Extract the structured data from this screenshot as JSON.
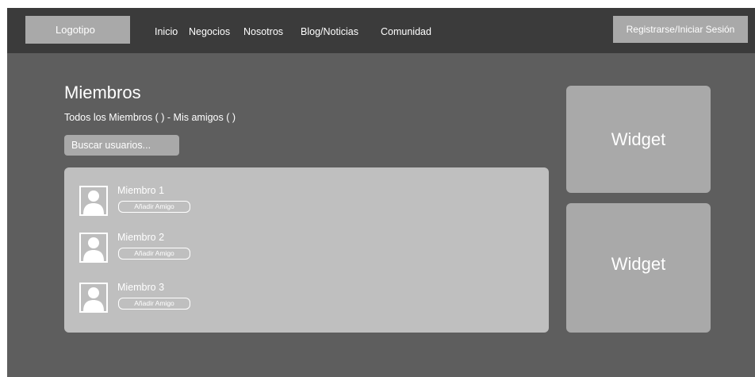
{
  "header": {
    "logo": "Logotipo",
    "nav": [
      {
        "label": "Inicio"
      },
      {
        "label": "Negocios"
      },
      {
        "label": "Nosotros"
      },
      {
        "label": "Blog/Noticias"
      },
      {
        "label": "Comunidad"
      }
    ],
    "auth_button": "Registrarse/Iniciar Sesión"
  },
  "main": {
    "title": "Miembros",
    "filters": {
      "all_members": "Todos los Miembros ( )",
      "separator": " - ",
      "my_friends": "Mis amigos ( )"
    },
    "search": {
      "placeholder": "Buscar usuarios...",
      "value": ""
    },
    "members": [
      {
        "name": "Miembro 1",
        "action": "Añadir Amigo"
      },
      {
        "name": "Miembro 2",
        "action": "Añadir Amigo"
      },
      {
        "name": "Miembro 3",
        "action": "Añadir Amigo"
      }
    ]
  },
  "sidebar": {
    "widgets": [
      {
        "label": "Widget"
      },
      {
        "label": "Widget"
      }
    ]
  },
  "colors": {
    "page_background": "#5e5e5e",
    "header_background": "#3b3b3b",
    "button_gray": "#a9a9a9",
    "panel_gray": "#bfbfbf",
    "text": "#ffffff"
  }
}
